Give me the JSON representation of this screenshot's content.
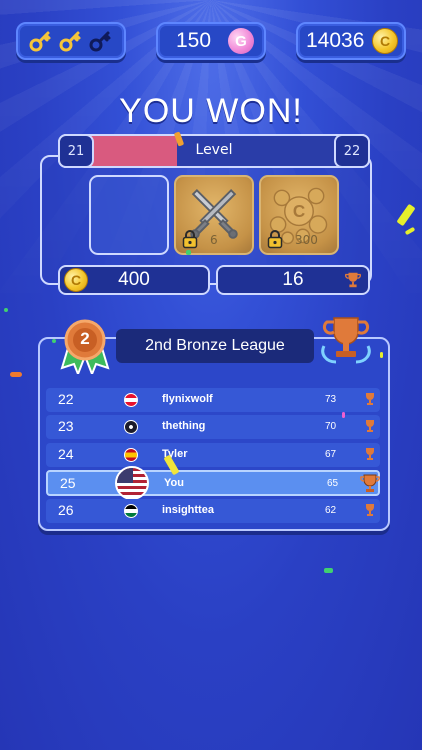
{
  "hud": {
    "keys": [
      {
        "icon": "gold-key-icon",
        "collected": true
      },
      {
        "icon": "gold-key-icon",
        "collected": true
      },
      {
        "icon": "dark-key-icon",
        "collected": false
      }
    ],
    "gems": "150",
    "gem_icon": "gem-icon",
    "gem_symbol": "G",
    "coins": "14036",
    "coin_icon": "coin-icon",
    "coin_symbol": "C"
  },
  "result_title": "YOU WON!",
  "level": {
    "label": "Level",
    "current": "21",
    "next": "22",
    "progress": 0.38
  },
  "rewards": [
    {
      "type": "empty"
    },
    {
      "type": "swords",
      "icon": "crossed-swords-icon",
      "locked": true,
      "count": "6"
    },
    {
      "type": "coins",
      "icon": "coin-pile-icon",
      "locked": true,
      "count": "300"
    }
  ],
  "earned": {
    "coins": "400",
    "trophies": "16"
  },
  "league": {
    "rank_badge": "2",
    "name": "2nd Bronze League",
    "rows": [
      {
        "rank": "22",
        "flag": "austria",
        "name": "flynixwolf",
        "score": "73",
        "you": false
      },
      {
        "rank": "23",
        "flag": "pirate",
        "name": "thething",
        "score": "70",
        "you": false
      },
      {
        "rank": "24",
        "flag": "spain",
        "name": "Tyler",
        "score": "67",
        "you": false
      },
      {
        "rank": "25",
        "flag": "usa",
        "name": "You",
        "score": "65",
        "you": true
      },
      {
        "rank": "26",
        "flag": "jordan",
        "name": "insighttea",
        "score": "62",
        "you": false
      }
    ]
  },
  "colors": {
    "background": "#2a40c4",
    "level_fill": "#d95a7f",
    "panel": "#2c47c9",
    "highlight_row": "#5b8ff0",
    "bronze": "#e07a3a"
  }
}
